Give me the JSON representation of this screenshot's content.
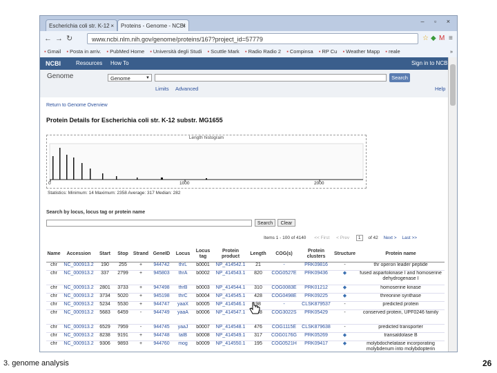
{
  "browser": {
    "tabs": [
      {
        "label": "Escherichia coli str. K-12"
      },
      {
        "label": "Proteins - Genome - NCBI"
      }
    ],
    "tab_close": "×",
    "window_controls": "– ▫ ×",
    "url": "www.ncbi.nlm.nih.gov/genome/proteins/167?project_id=57779",
    "bookmarks": [
      "Gmail",
      "Posta in arriv.",
      "PubMed Home",
      "Università degli Studi",
      "Scuttle Mark",
      "Radio Radio 2",
      "Compinsa",
      "RP Cu",
      "Weather Mapp",
      "reale"
    ],
    "more_bookmarks": "»"
  },
  "ncbi": {
    "logo": "NCBI",
    "resources": "Resources",
    "how_to": "How To",
    "sign_in": "Sign in to NCBI",
    "db_label": "Genome",
    "db_select": "Genome",
    "search_button": "Search",
    "limits": "Limits",
    "advanced": "Advanced",
    "help": "Help"
  },
  "page": {
    "back_link": "Return to Genome Overview",
    "title": "Protein Details for Escherichia coli str. K-12 substr. MG1655",
    "histogram": {
      "title": "Length histogram",
      "ticks": [
        "0",
        "1000",
        "2000"
      ],
      "statistics_label": "Statistics:",
      "statistics": "Minimum: 14 Maximum: 2358 Average: 317 Median: 282"
    },
    "search_label": "Search by locus, locus tag or protein name",
    "search_btn": "Search",
    "clear_btn": "Clear",
    "pager": {
      "items": "Items 1 - 100 of 4140",
      "first": "<< First",
      "prev": "< Prev",
      "page": "1",
      "of": "of 42",
      "next": "Next >",
      "last": "Last >>"
    },
    "columns": [
      "Name",
      "Accession",
      "Start",
      "Stop",
      "Strand",
      "GeneID",
      "Locus",
      "Locus tag",
      "Protein product",
      "Length",
      "COG(s)",
      "Protein clusters",
      "Structure",
      "Protein name"
    ],
    "rows": [
      [
        "chr",
        "NC_000913.2",
        "190",
        "255",
        "+",
        "944742",
        "thrL",
        "b0001",
        "NP_414542.1",
        "21",
        "-",
        "PRK09816",
        "-",
        "thr operon leader peptide"
      ],
      [
        "chr",
        "NC_000913.2",
        "337",
        "2799",
        "+",
        "945803",
        "thrA",
        "b0002",
        "NP_414543.1",
        "820",
        "COG0527E",
        "PRK09436",
        "◆",
        "fused aspartokinase I and homoserine dehydrogenase I"
      ],
      [
        "chr",
        "NC_000913.2",
        "2801",
        "3733",
        "+",
        "947498",
        "thrB",
        "b0003",
        "NP_414544.1",
        "310",
        "COG0083E",
        "PRK01212",
        "◆",
        "homoserine kinase"
      ],
      [
        "chr",
        "NC_000913.2",
        "3734",
        "5020",
        "+",
        "945198",
        "thrC",
        "b0004",
        "NP_414545.1",
        "428",
        "COG0498E",
        "PRK09225",
        "◆",
        "threonine synthase"
      ],
      [
        "chr",
        "NC_000913.2",
        "5234",
        "5530",
        "+",
        "944747",
        "yaaX",
        "b0005",
        "NP_414546.1",
        "98",
        "-",
        "CLSK879537",
        "-",
        "predicted protein"
      ],
      [
        "chr",
        "NC_000913.2",
        "5683",
        "6459",
        "-",
        "944749",
        "yaaA",
        "b0006",
        "NP_414547.1",
        "258",
        "COG3022S",
        "PRK05429",
        "-",
        "conserved protein, UPF0246 family"
      ],
      [
        "chr",
        "NC_000913.2",
        "6529",
        "7959",
        "-",
        "944745",
        "yaaJ",
        "b0007",
        "NP_414548.1",
        "476",
        "COG1115E",
        "CLSK879638",
        "-",
        "predicted transporter"
      ],
      [
        "chr",
        "NC_000913.2",
        "8238",
        "9191",
        "+",
        "944748",
        "talB",
        "b0008",
        "NP_414549.1",
        "317",
        "COG0176G",
        "PRK05269",
        "◆",
        "transaldolase B"
      ],
      [
        "chr",
        "NC_000913.2",
        "9306",
        "9893",
        "+",
        "944760",
        "mog",
        "b0009",
        "NP_414550.1",
        "195",
        "COG0521H",
        "PRK09417",
        "◆",
        "molybdochelatase incorporating molybdenum into molybdopterin"
      ]
    ]
  },
  "slide": {
    "caption": "3. genome analysis",
    "page_number": "26"
  }
}
